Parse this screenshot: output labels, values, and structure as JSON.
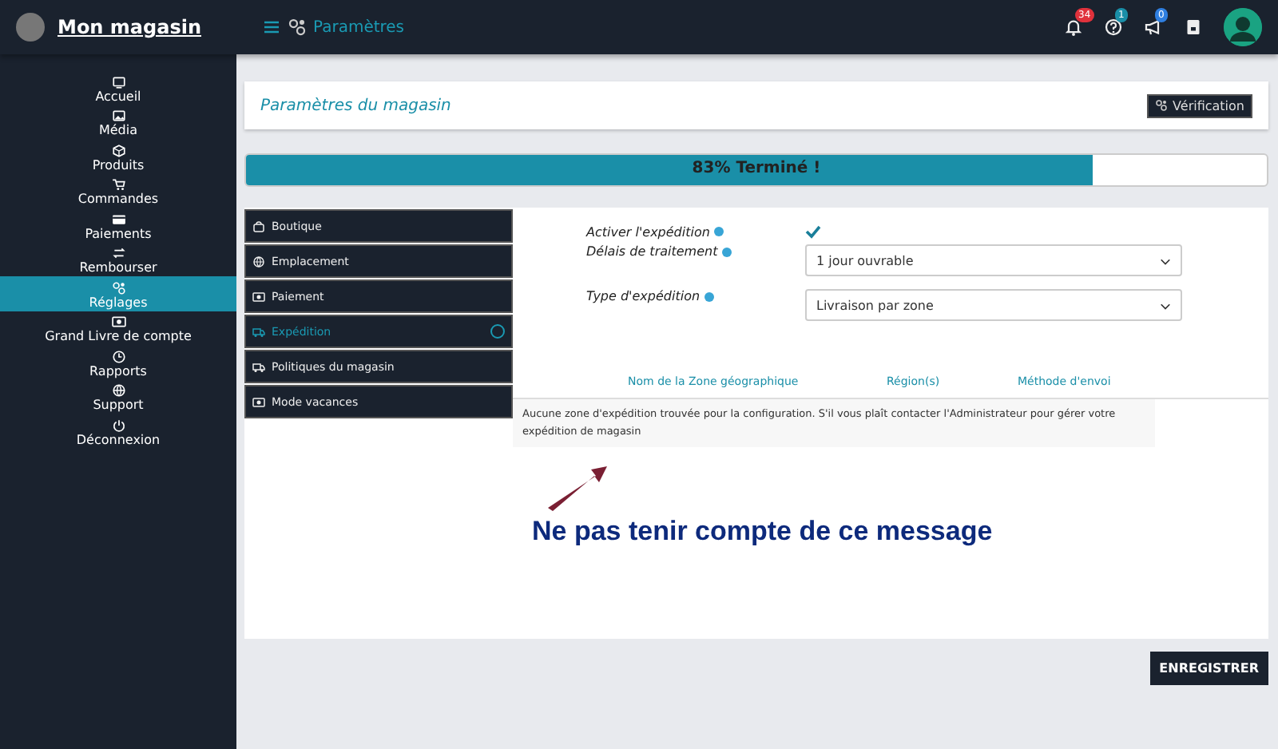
{
  "topbar": {
    "store_name": "Mon magasin",
    "page_title": "Paramètres",
    "badges": [
      {
        "kind": "bell",
        "count": "34",
        "color": "#e0323c"
      },
      {
        "kind": "help",
        "count": "1",
        "color": "#1a8fa8"
      },
      {
        "kind": "megaphone",
        "count": "0",
        "color": "#2f7fe0"
      },
      {
        "kind": "book"
      }
    ]
  },
  "sidebar": {
    "items": [
      {
        "label": "Accueil",
        "selected": false
      },
      {
        "label": "Média",
        "selected": false
      },
      {
        "label": "Produits",
        "selected": false
      },
      {
        "label": "Commandes",
        "selected": false
      },
      {
        "label": "Paiements",
        "selected": false
      },
      {
        "label": "Rembourser",
        "selected": false
      },
      {
        "label": "Réglages",
        "selected": true
      },
      {
        "label": "Grand Livre de compte",
        "selected": false
      },
      {
        "label": "Rapports",
        "selected": false
      },
      {
        "label": "Support",
        "selected": false
      },
      {
        "label": "Déconnexion",
        "selected": false
      }
    ]
  },
  "header": {
    "title": "Paramètres du magasin",
    "button": "Vérification"
  },
  "progress": {
    "label": "83% Terminé !",
    "level": 0.83
  },
  "settings_menu": [
    {
      "label": "Boutique",
      "selected": false
    },
    {
      "label": "Emplacement",
      "selected": false
    },
    {
      "label": "Paiement",
      "selected": false
    },
    {
      "label": "Expédition",
      "selected": true
    },
    {
      "label": "Politiques du magasin",
      "selected": false
    },
    {
      "label": "Mode vacances",
      "selected": false
    }
  ],
  "form": {
    "enable_shipping": {
      "label": "Activer l'expédition",
      "checked": true
    },
    "processing_time": {
      "label": "Délais de traitement",
      "value": "1 jour ouvrable"
    },
    "shipping_type": {
      "label": "Type d'expédition",
      "value": "Livraison par zone"
    }
  },
  "table": {
    "columns": [
      "Nom de la Zone géographique",
      "Région(s)",
      "Méthode d'envoi"
    ],
    "empty_message": "Aucune zone d'expédition trouvée pour la configuration. S'il vous plaît contacter l'Administrateur pour gérer votre expédition de magasin"
  },
  "annotation": "Ne pas tenir compte de ce message",
  "save_button": "ENREGISTRER"
}
